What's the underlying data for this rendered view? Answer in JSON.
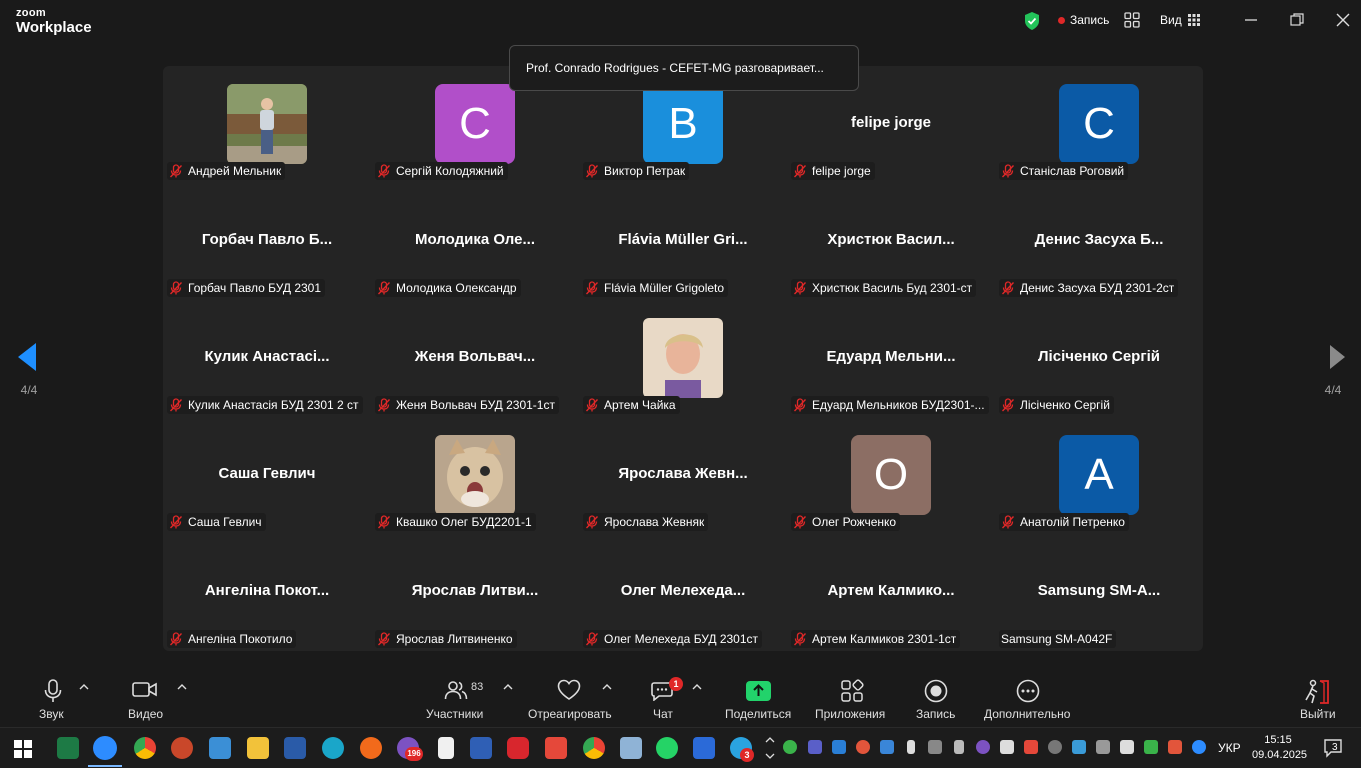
{
  "app": {
    "logo_line1": "zoom",
    "logo_line2": "Workplace"
  },
  "titlebar": {
    "record_label": "Запись",
    "view_label": "Вид"
  },
  "banner": {
    "text": "Prof. Conrado Rodrigues - CEFET-MG разговаривает..."
  },
  "paging": {
    "left": "4/4",
    "right": "4/4"
  },
  "participants": [
    {
      "center": "",
      "label": "Андрей Мельник",
      "type": "photo",
      "photo": "boy"
    },
    {
      "center": "С",
      "label": "Сергій Колодяжний",
      "type": "avatar",
      "color": "#b14fc9"
    },
    {
      "center": "В",
      "label": "Виктор Петрак",
      "type": "avatar",
      "color": "#1a8fdc"
    },
    {
      "center": "felipe jorge",
      "label": "felipe jorge",
      "type": "name"
    },
    {
      "center": "С",
      "label": "Станіслав Роговий",
      "type": "avatar",
      "color": "#0b5aa6"
    },
    {
      "center": "Горбач Павло Б...",
      "label": "Горбач Павло БУД 2301",
      "type": "name"
    },
    {
      "center": "Молодика Оле...",
      "label": "Молодика Олександр",
      "type": "name"
    },
    {
      "center": "Flávia Müller Gri...",
      "label": "Flávia Müller Grigoleto",
      "type": "name"
    },
    {
      "center": "Христюк Васил...",
      "label": "Христюк Василь Буд 2301-ст",
      "type": "name"
    },
    {
      "center": "Денис Засуха Б...",
      "label": "Денис Засуха БУД 2301-2ст",
      "type": "name"
    },
    {
      "center": "Кулик Анастасі...",
      "label": "Кулик Анастасія БУД 2301 2 ст",
      "type": "name"
    },
    {
      "center": "Женя Вольвач...",
      "label": "Женя Вольвач БУД 2301-1ст",
      "type": "name"
    },
    {
      "center": "",
      "label": "Артем Чайка",
      "type": "photo",
      "photo": "teen"
    },
    {
      "center": "Едуард Мельни...",
      "label": "Едуард Мельников БУД2301-...",
      "type": "name"
    },
    {
      "center": "Лісіченко Сергій",
      "label": "Лісіченко Сергій",
      "type": "name"
    },
    {
      "center": "Саша Гевлич",
      "label": "Саша Гевлич",
      "type": "name"
    },
    {
      "center": "",
      "label": "Квашко Олег БУД2201-1",
      "type": "photo",
      "photo": "cat"
    },
    {
      "center": "Ярослава Жевн...",
      "label": "Ярослава Жевняк",
      "type": "name"
    },
    {
      "center": "О",
      "label": "Олег Рожченко",
      "type": "avatar",
      "color": "#8c6e64"
    },
    {
      "center": "А",
      "label": "Анатолій Петренко",
      "type": "avatar",
      "color": "#0b5aa6"
    },
    {
      "center": "Ангеліна Покот...",
      "label": "Ангеліна Покотило",
      "type": "name"
    },
    {
      "center": "Ярослав Литви...",
      "label": "Ярослав Литвиненко",
      "type": "name"
    },
    {
      "center": "Олег Мелехеда...",
      "label": "Олег Мелехеда БУД 2301ст",
      "type": "name"
    },
    {
      "center": "Артем Калмико...",
      "label": "Артем Калмиков 2301-1ст",
      "type": "name"
    },
    {
      "center": "Samsung SM-A...",
      "label": "Samsung SM-A042F",
      "type": "name",
      "muted": false
    }
  ],
  "toolbar": {
    "audio": "Звук",
    "video": "Видео",
    "participants": "Участники",
    "participants_count": "83",
    "react": "Отреагировать",
    "chat": "Чат",
    "chat_badge": "1",
    "share": "Поделиться",
    "apps": "Приложения",
    "record": "Запись",
    "more": "Дополнительно",
    "leave": "Выйти"
  },
  "taskbar": {
    "viber_badge": "196",
    "telegram_badge": "3",
    "lang": "УКР",
    "time": "15:15",
    "date": "09.04.2025",
    "notif_count": "3"
  }
}
